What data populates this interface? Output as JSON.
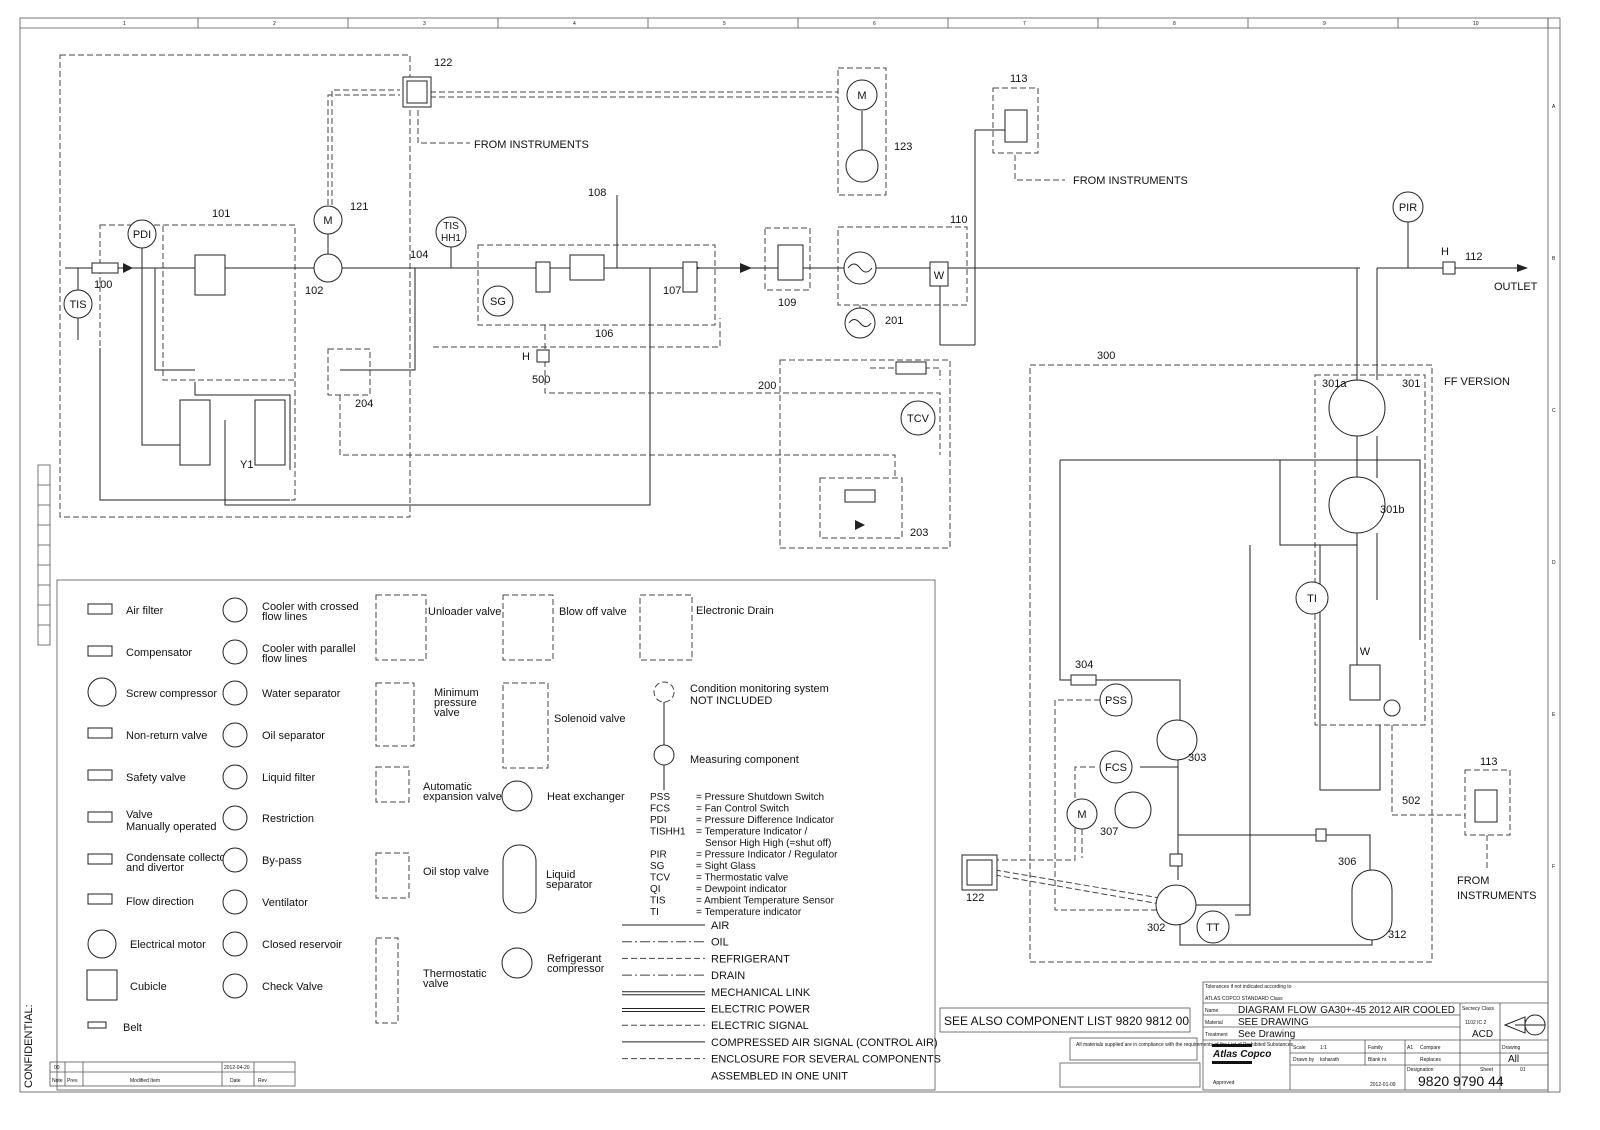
{
  "components": {
    "c100": "100",
    "c101": "101",
    "c102": "102",
    "c104": "104",
    "c106": "106",
    "c107": "107",
    "c108": "108",
    "c109": "109",
    "c110": "110",
    "c112": "112",
    "c113a": "113",
    "c113b": "113",
    "c121": "121",
    "c122a": "122",
    "c122b": "122",
    "c123": "123",
    "c200": "200",
    "c201": "201",
    "c203": "203",
    "c204": "204",
    "c300": "300",
    "c301": "301",
    "c301a": "301a",
    "c301b": "301b",
    "c302": "302",
    "c303": "303",
    "c304": "304",
    "c306": "306",
    "c307": "307",
    "c312": "312",
    "c500": "500",
    "c502": "502",
    "y1": "Y1"
  },
  "instruments": {
    "pdi": "PDI",
    "tis1": "TIS",
    "m121": "M",
    "tis2": "TIS",
    "hh1": "HH1",
    "sg": "SG",
    "m123": "M",
    "pir": "PIR",
    "h1": "H",
    "h2": "H",
    "tcv": "TCV",
    "ti": "TI",
    "pss": "PSS",
    "fcs": "FCS",
    "m307": "M",
    "tt": "TT",
    "w1": "W",
    "w2": "W"
  },
  "annotations": {
    "from_instruments_1": "FROM INSTRUMENTS",
    "from_instruments_2": "FROM INSTRUMENTS",
    "from_instruments_3a": "FROM",
    "from_instruments_3b": "INSTRUMENTS",
    "outlet": "OUTLET",
    "ff_version": "FF VERSION",
    "see_also": "SEE ALSO COMPONENT LIST 9820 9812 00",
    "confidential": "CONFIDENTIAL:"
  },
  "grid_columns": [
    "1",
    "2",
    "3",
    "4",
    "5",
    "6",
    "7",
    "8",
    "9",
    "10"
  ],
  "grid_rows": [
    "A",
    "B",
    "C",
    "D",
    "E",
    "F"
  ],
  "legend": {
    "col1": [
      "Air filter",
      "Compensator",
      "Screw compressor",
      "Non-return valve",
      "Safety valve",
      "Valve",
      "Manually operated",
      "Condensate collector",
      "and divertor",
      "Flow direction",
      "Electrical motor",
      "Cubicle",
      "Belt"
    ],
    "col2": [
      "Cooler with crossed",
      "flow lines",
      "Cooler with parallel",
      "flow lines",
      "Water separator",
      "Oil separator",
      "Liquid filter",
      "Restriction",
      "By-pass",
      "Ventilator",
      "Closed reservoir",
      "Check Valve"
    ],
    "col3": [
      "Unloader valve",
      "Minimum",
      "pressure",
      "valve",
      "Automatic",
      "expansion valve",
      "Oil stop valve",
      "Thermostatic",
      "valve"
    ],
    "col4": [
      "Blow off valve",
      "Solenoid valve",
      "Heat exchanger",
      "Liquid",
      "separator",
      "Refrigerant",
      "compressor",
      "QI"
    ],
    "col5": [
      "Electronic Drain",
      "Condition monitoring system",
      "NOT INCLUDED",
      "Measuring component"
    ],
    "abbreviations": [
      {
        "abbr": "PSS",
        "desc": "= Pressure Shutdown Switch"
      },
      {
        "abbr": "FCS",
        "desc": "= Fan Control Switch"
      },
      {
        "abbr": "PDI",
        "desc": "= Pressure Difference Indicator"
      },
      {
        "abbr": "TISHH1",
        "desc": "= Temperature Indicator /"
      },
      {
        "abbr": "",
        "desc": "Sensor High High (=shut off)"
      },
      {
        "abbr": "PIR",
        "desc": "= Pressure Indicator / Regulator"
      },
      {
        "abbr": "SG",
        "desc": "= Sight Glass"
      },
      {
        "abbr": "TCV",
        "desc": "= Thermostatic valve"
      },
      {
        "abbr": "QI",
        "desc": "= Dewpoint indicator"
      },
      {
        "abbr": "TIS",
        "desc": "= Ambient Temperature Sensor"
      },
      {
        "abbr": "TI",
        "desc": "= Temperature indicator"
      }
    ],
    "line_types": [
      "AIR",
      "OIL",
      "REFRIGERANT",
      "DRAIN",
      "MECHANICAL LINK",
      "ELECTRIC POWER",
      "ELECTRIC SIGNAL",
      "COMPRESSED AIR SIGNAL (CONTROL AIR)",
      "ENCLOSURE FOR SEVERAL COMPONENTS",
      "ASSEMBLED IN ONE UNIT"
    ]
  },
  "title_block": {
    "tolerances": "Tolerances if not indicated according to",
    "standard": "ATLAS COPCO STANDARD Class",
    "name_label": "Name",
    "name": "DIAGRAM FLOW",
    "model": "GA30+-45 2012 AIR COOLED",
    "material_label": "Material",
    "material": "SEE DRAWING",
    "treatment_label": "Treatment",
    "treatment": "See Drawing",
    "secrecy_label": "Secrecy Class",
    "secrecy_code": "1102 IC 2",
    "secrecy": "ACD",
    "scale_label": "Scale",
    "scale": "1:1",
    "family_label": "Family",
    "size": "A1",
    "compare_label": "Compare",
    "replaces_label": "Replaces",
    "drawn_by_label": "Drawn by",
    "drawn_by": "ksharath",
    "blank_label": "Blank nr.",
    "drawing_label": "Drawing",
    "drawing_value": "All",
    "designation_label": "Designation",
    "sheet_label": "Sheet",
    "sheet": "01",
    "drawing_number": "9820 9790 44",
    "approved": "Approved",
    "date": "2012-01-09",
    "brand": "Atlas Copco",
    "compliance": "All materials supplied are in compliance with the requirements of the List of Prohibited Substances",
    "rev_date": "2012-04-20",
    "rev_no": "00",
    "rev_note_label": "Modified Item",
    "date_label": "Date",
    "rev_label": "Rev",
    "prev_label": "Prev.",
    "note_label": "Note"
  }
}
